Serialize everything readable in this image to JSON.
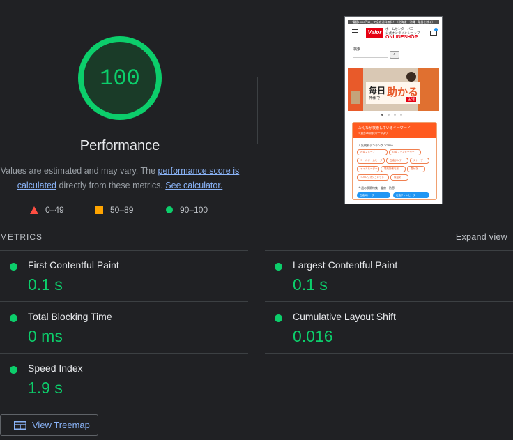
{
  "gauge": {
    "score": "100",
    "title": "Performance",
    "fraction": 1.0,
    "color": "#0cce6b"
  },
  "description": {
    "prefix": "Values are estimated and may vary. The ",
    "link1": "performance score is calculated",
    "middle": " directly from these metrics. ",
    "link2": "See calculator."
  },
  "legend": [
    {
      "icon": "triangle-icon",
      "label": "0–49",
      "color": "#ff4e42"
    },
    {
      "icon": "square-icon",
      "label": "50–89",
      "color": "#ffa400"
    },
    {
      "icon": "circle-icon",
      "label": "90–100",
      "color": "#0cce6b"
    }
  ],
  "metrics": {
    "title": "METRICS",
    "expand_label": "Expand view",
    "items": [
      {
        "label": "First Contentful Paint",
        "value": "0.1 s"
      },
      {
        "label": "Largest Contentful Paint",
        "value": "0.1 s"
      },
      {
        "label": "Total Blocking Time",
        "value": "0 ms"
      },
      {
        "label": "Cumulative Layout Shift",
        "value": "0.016"
      },
      {
        "label": "Speed Index",
        "value": "1.9 s"
      }
    ]
  },
  "treemap_button": "View Treemap",
  "screenshot": {
    "topbar": "電話1,000円以上で全店送料無料！（北海道・沖縄・離島を除く）",
    "logo": "Valor",
    "store_line1": "ホームセンターバロー",
    "store_line2": "公式オンラインショップ",
    "store_name": "ONLINESHOP",
    "search_label": "検索",
    "banner_big": "毎日",
    "banner_small": "神様 で",
    "banner_accent": "助かる",
    "banner_tag": "生活",
    "keyword_title": "みんなが検索しているキーワード",
    "keyword_sub": "※過去24時間のデータより",
    "ranking_title": "人気検索ランキング TOP10",
    "tags": [
      "石油ストーブ",
      "灯油ファンヒーター",
      "コールドームヒーター",
      "石油ポンプ",
      "電気毛布",
      "ストーブ",
      "オイルヒーター",
      "電気掛敷毛布",
      "雪かき",
      "TOTOウォシュレット",
      "除湿剤"
    ],
    "recommend_title": "今週の季節特集・暖房・防寒",
    "blue_tags": [
      "石油ストーブ",
      "石油ファンヒーター"
    ]
  }
}
